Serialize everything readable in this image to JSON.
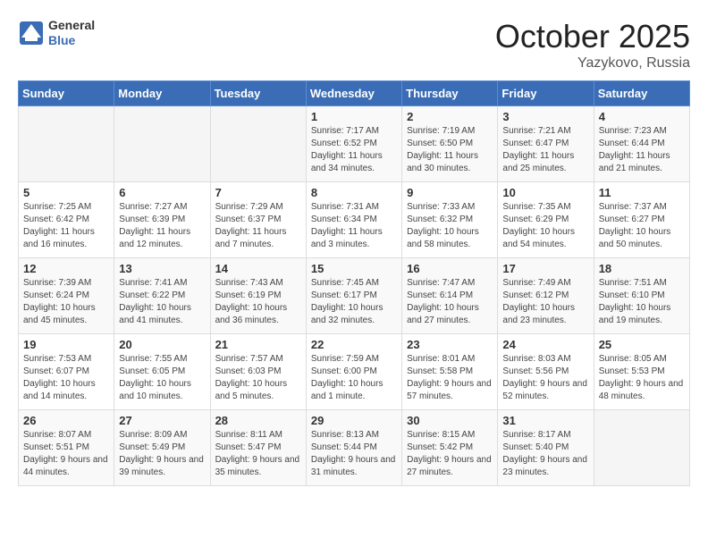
{
  "header": {
    "logo_general": "General",
    "logo_blue": "Blue",
    "month": "October 2025",
    "location": "Yazykovo, Russia"
  },
  "days_header": [
    "Sunday",
    "Monday",
    "Tuesday",
    "Wednesday",
    "Thursday",
    "Friday",
    "Saturday"
  ],
  "weeks": [
    [
      {
        "day": "",
        "info": ""
      },
      {
        "day": "",
        "info": ""
      },
      {
        "day": "",
        "info": ""
      },
      {
        "day": "1",
        "info": "Sunrise: 7:17 AM\nSunset: 6:52 PM\nDaylight: 11 hours and 34 minutes."
      },
      {
        "day": "2",
        "info": "Sunrise: 7:19 AM\nSunset: 6:50 PM\nDaylight: 11 hours and 30 minutes."
      },
      {
        "day": "3",
        "info": "Sunrise: 7:21 AM\nSunset: 6:47 PM\nDaylight: 11 hours and 25 minutes."
      },
      {
        "day": "4",
        "info": "Sunrise: 7:23 AM\nSunset: 6:44 PM\nDaylight: 11 hours and 21 minutes."
      }
    ],
    [
      {
        "day": "5",
        "info": "Sunrise: 7:25 AM\nSunset: 6:42 PM\nDaylight: 11 hours and 16 minutes."
      },
      {
        "day": "6",
        "info": "Sunrise: 7:27 AM\nSunset: 6:39 PM\nDaylight: 11 hours and 12 minutes."
      },
      {
        "day": "7",
        "info": "Sunrise: 7:29 AM\nSunset: 6:37 PM\nDaylight: 11 hours and 7 minutes."
      },
      {
        "day": "8",
        "info": "Sunrise: 7:31 AM\nSunset: 6:34 PM\nDaylight: 11 hours and 3 minutes."
      },
      {
        "day": "9",
        "info": "Sunrise: 7:33 AM\nSunset: 6:32 PM\nDaylight: 10 hours and 58 minutes."
      },
      {
        "day": "10",
        "info": "Sunrise: 7:35 AM\nSunset: 6:29 PM\nDaylight: 10 hours and 54 minutes."
      },
      {
        "day": "11",
        "info": "Sunrise: 7:37 AM\nSunset: 6:27 PM\nDaylight: 10 hours and 50 minutes."
      }
    ],
    [
      {
        "day": "12",
        "info": "Sunrise: 7:39 AM\nSunset: 6:24 PM\nDaylight: 10 hours and 45 minutes."
      },
      {
        "day": "13",
        "info": "Sunrise: 7:41 AM\nSunset: 6:22 PM\nDaylight: 10 hours and 41 minutes."
      },
      {
        "day": "14",
        "info": "Sunrise: 7:43 AM\nSunset: 6:19 PM\nDaylight: 10 hours and 36 minutes."
      },
      {
        "day": "15",
        "info": "Sunrise: 7:45 AM\nSunset: 6:17 PM\nDaylight: 10 hours and 32 minutes."
      },
      {
        "day": "16",
        "info": "Sunrise: 7:47 AM\nSunset: 6:14 PM\nDaylight: 10 hours and 27 minutes."
      },
      {
        "day": "17",
        "info": "Sunrise: 7:49 AM\nSunset: 6:12 PM\nDaylight: 10 hours and 23 minutes."
      },
      {
        "day": "18",
        "info": "Sunrise: 7:51 AM\nSunset: 6:10 PM\nDaylight: 10 hours and 19 minutes."
      }
    ],
    [
      {
        "day": "19",
        "info": "Sunrise: 7:53 AM\nSunset: 6:07 PM\nDaylight: 10 hours and 14 minutes."
      },
      {
        "day": "20",
        "info": "Sunrise: 7:55 AM\nSunset: 6:05 PM\nDaylight: 10 hours and 10 minutes."
      },
      {
        "day": "21",
        "info": "Sunrise: 7:57 AM\nSunset: 6:03 PM\nDaylight: 10 hours and 5 minutes."
      },
      {
        "day": "22",
        "info": "Sunrise: 7:59 AM\nSunset: 6:00 PM\nDaylight: 10 hours and 1 minute."
      },
      {
        "day": "23",
        "info": "Sunrise: 8:01 AM\nSunset: 5:58 PM\nDaylight: 9 hours and 57 minutes."
      },
      {
        "day": "24",
        "info": "Sunrise: 8:03 AM\nSunset: 5:56 PM\nDaylight: 9 hours and 52 minutes."
      },
      {
        "day": "25",
        "info": "Sunrise: 8:05 AM\nSunset: 5:53 PM\nDaylight: 9 hours and 48 minutes."
      }
    ],
    [
      {
        "day": "26",
        "info": "Sunrise: 8:07 AM\nSunset: 5:51 PM\nDaylight: 9 hours and 44 minutes."
      },
      {
        "day": "27",
        "info": "Sunrise: 8:09 AM\nSunset: 5:49 PM\nDaylight: 9 hours and 39 minutes."
      },
      {
        "day": "28",
        "info": "Sunrise: 8:11 AM\nSunset: 5:47 PM\nDaylight: 9 hours and 35 minutes."
      },
      {
        "day": "29",
        "info": "Sunrise: 8:13 AM\nSunset: 5:44 PM\nDaylight: 9 hours and 31 minutes."
      },
      {
        "day": "30",
        "info": "Sunrise: 8:15 AM\nSunset: 5:42 PM\nDaylight: 9 hours and 27 minutes."
      },
      {
        "day": "31",
        "info": "Sunrise: 8:17 AM\nSunset: 5:40 PM\nDaylight: 9 hours and 23 minutes."
      },
      {
        "day": "",
        "info": ""
      }
    ]
  ]
}
